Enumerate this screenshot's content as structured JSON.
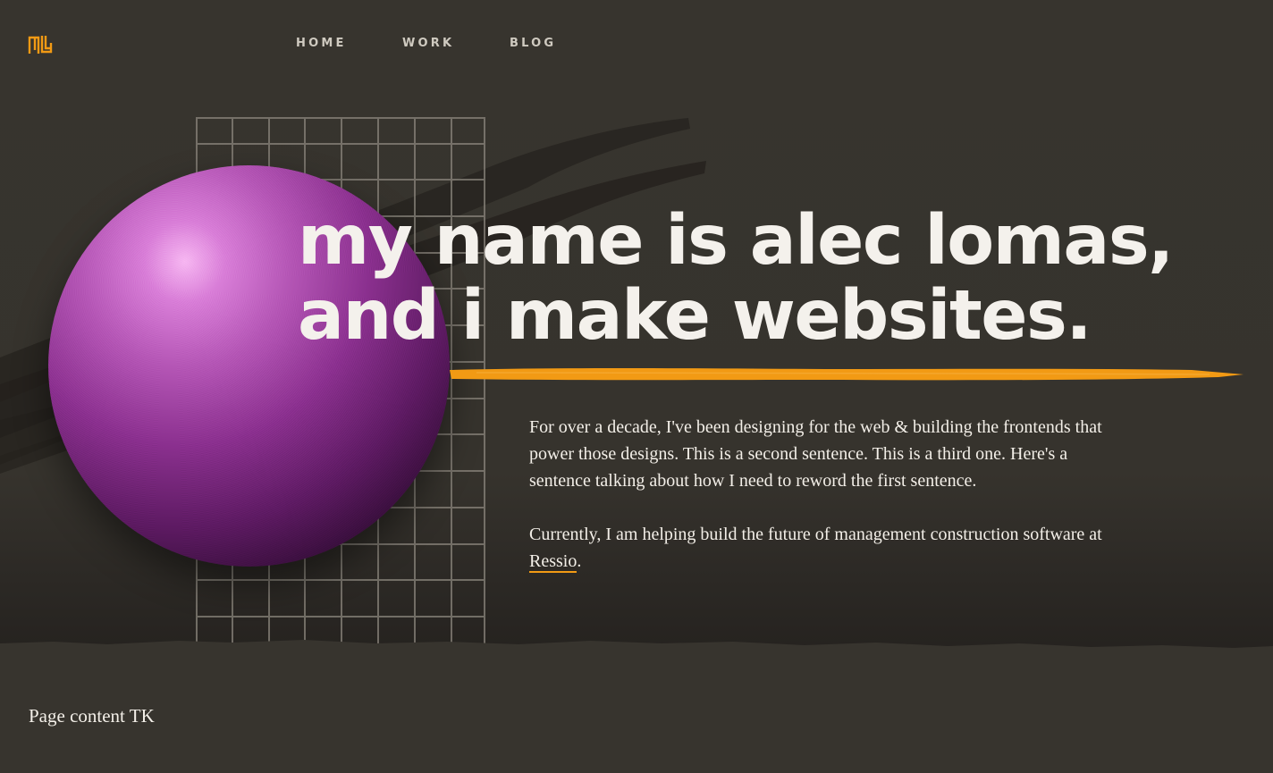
{
  "nav": {
    "items": [
      {
        "label": "HOME"
      },
      {
        "label": "WORK"
      },
      {
        "label": "BLOG"
      }
    ]
  },
  "hero": {
    "headline_line1": "my name is alec lomas,",
    "headline_line2": "and i make websites.",
    "paragraph1": "For over a decade, I've been designing for the web & building the frontends that power those designs. This is a second sentence. This is a third one. Here's a sentence talking about how I need to reword the first sentence.",
    "paragraph2_prefix": "Currently, I am helping build the future of management construction software at ",
    "paragraph2_link": "Ressio",
    "paragraph2_suffix": "."
  },
  "footer": {
    "text": "Page content TK"
  },
  "colors": {
    "background": "#37342e",
    "accent": "#f29a14",
    "text": "#f3efe8",
    "nav_text": "#cfcac0",
    "sphere": "#8a2f8e"
  },
  "icons": {
    "logo": "al-monogram-logo"
  }
}
